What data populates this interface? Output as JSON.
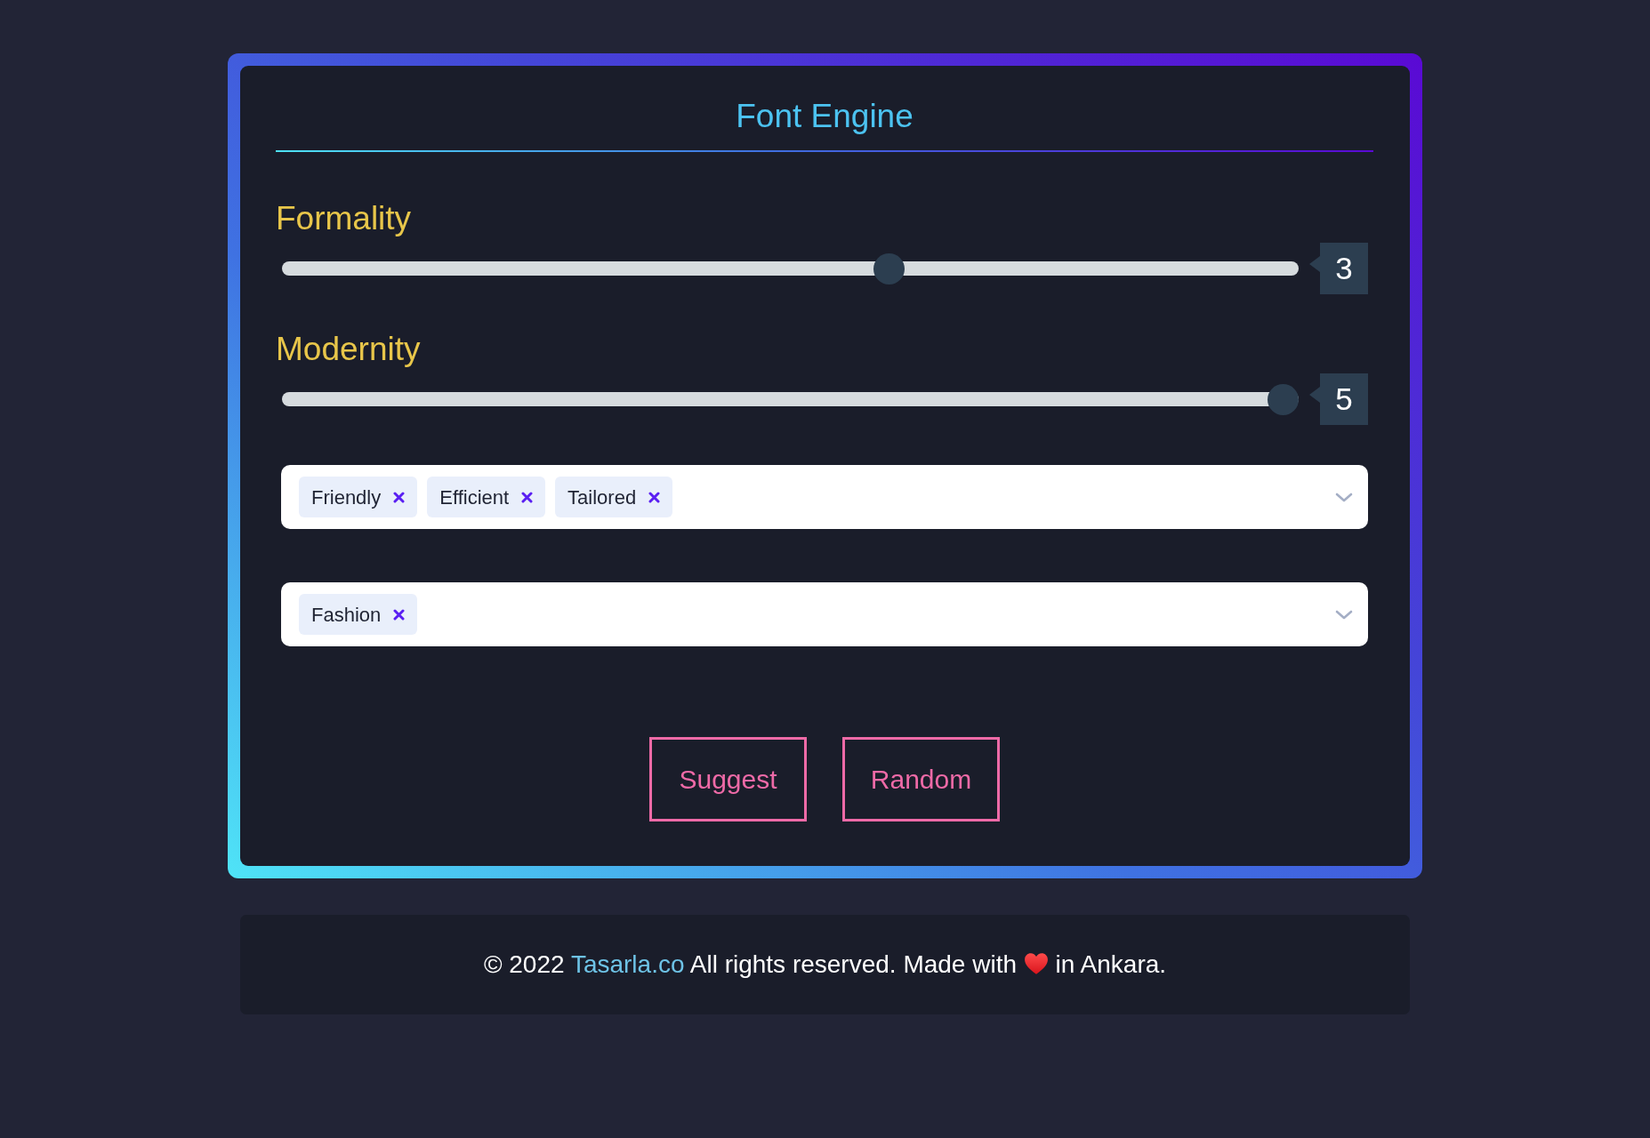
{
  "title": "Font Engine",
  "sliders": [
    {
      "label": "Formality",
      "level": 0.6,
      "reading": "3"
    },
    {
      "label": "Modernity",
      "level": 1,
      "reading": "5"
    }
  ],
  "selects": [
    {
      "tags": [
        "Friendly",
        "Efficient",
        "Tailored"
      ]
    },
    {
      "tags": [
        "Fashion"
      ]
    }
  ],
  "buttons": [
    "Suggest",
    "Random"
  ],
  "footer": {
    "copyright": "© 2022",
    "link": "Tasarla.co",
    "middle": "All rights reserved. Made with",
    "end": "in Ankara."
  }
}
